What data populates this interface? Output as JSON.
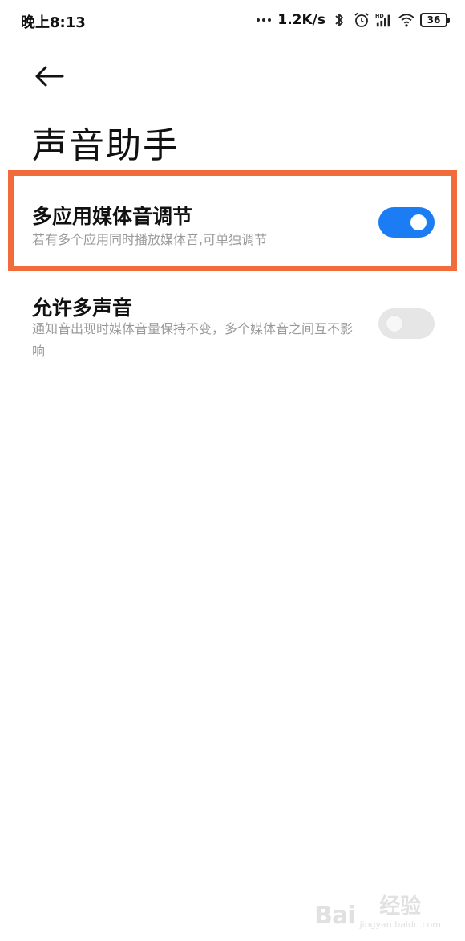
{
  "status_bar": {
    "time": "晚上8:13",
    "net_speed": "1.2K/s",
    "battery": "36",
    "icons": [
      "dots-icon",
      "bluetooth-icon",
      "alarm-icon",
      "hd-signal-icon",
      "wifi-icon",
      "battery-icon"
    ]
  },
  "header": {
    "back_icon": "back-arrow-icon",
    "title": "声音助手"
  },
  "settings": [
    {
      "title": "多应用媒体音调节",
      "description": "若有多个应用同时播放媒体音,可单独调节",
      "enabled": true
    },
    {
      "title": "允许多声音",
      "description": "通知音出现时媒体音量保持不变，多个媒体音之间互不影响",
      "enabled": false
    }
  ],
  "colors": {
    "toggle_on": "#1c7cf4",
    "toggle_off": "#e6e6e6",
    "highlight_frame": "#f26b3a"
  },
  "watermark": {
    "logo": "Bai",
    "brand": "经验",
    "url": "jingyan.baidu.com"
  }
}
